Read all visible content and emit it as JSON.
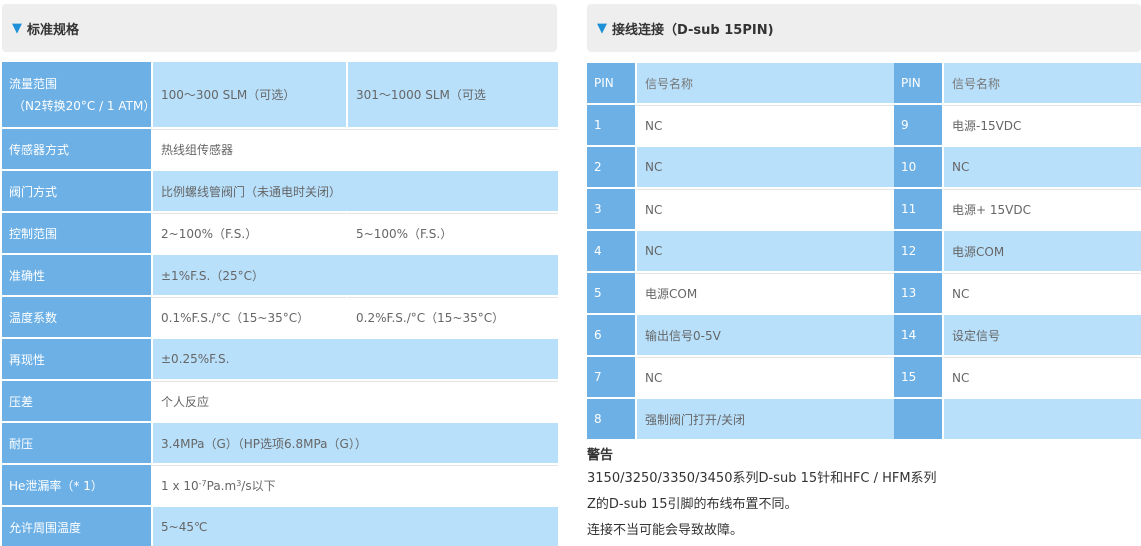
{
  "spec_section": {
    "title": "标准规格",
    "rows": [
      {
        "label": "流量范围",
        "sublabel": "（N2转换20°C / 1 ATM）",
        "value1": "100～300 SLM（可选）",
        "value2": "301～1000 SLM（可选"
      },
      {
        "label": "传感器方式",
        "value1": "热线组传感器"
      },
      {
        "label": "阀门方式",
        "value1": "比例螺线管阀门（未通电时关闭）"
      },
      {
        "label": "控制范围",
        "value1": "2~100%（F.S.）",
        "value2": "5~100%（F.S.）"
      },
      {
        "label": "准确性",
        "value1": "±1%F.S.（25°C）"
      },
      {
        "label": "温度系数",
        "value1": "0.1%F.S./°C（15~35°C）",
        "value2": "0.2%F.S./°C（15~35°C）"
      },
      {
        "label": "再现性",
        "value1": "±0.25%F.S."
      },
      {
        "label": "压差",
        "value1": "个人反应"
      },
      {
        "label": "耐压",
        "value1": "3.4MPa（G）（HP选项6.8MPa（G））"
      },
      {
        "label": "He泄漏率（* 1）",
        "value_prefix": "1 x 10",
        "value_exp1": "-7",
        "value_mid": " Pa.m",
        "value_exp2": "3",
        "value_suffix": "/s以下"
      },
      {
        "label": "允许周围温度",
        "value1": "5~45℃"
      }
    ]
  },
  "pin_section": {
    "title": "接线连接（D-sub 15PIN)",
    "header": {
      "pin": "PIN",
      "signal": "信号名称",
      "pin2": "PIN",
      "signal2": "信号名称"
    },
    "rows": [
      {
        "pin": "1",
        "signal": "NC",
        "pin2": "9",
        "signal2": "电源-15VDC"
      },
      {
        "pin": "2",
        "signal": "NC",
        "pin2": "10",
        "signal2": "NC"
      },
      {
        "pin": "3",
        "signal": "NC",
        "pin2": "11",
        "signal2": "电源+ 15VDC"
      },
      {
        "pin": "4",
        "signal": "NC",
        "pin2": "12",
        "signal2": "电源COM"
      },
      {
        "pin": "5",
        "signal": "电源COM",
        "pin2": "13",
        "signal2": "NC"
      },
      {
        "pin": "6",
        "signal": "输出信号0-5V",
        "pin2": "14",
        "signal2": "设定信号"
      },
      {
        "pin": "7",
        "signal": "NC",
        "pin2": "15",
        "signal2": "NC"
      },
      {
        "pin": "8",
        "signal": "强制阀门打开/关闭",
        "pin2": "",
        "signal2": ""
      }
    ]
  },
  "warning": {
    "title": "警告",
    "line1": "3150/3250/3350/3450系列D-sub 15针和HFC / HFM系列",
    "line2": "Z的D-sub 15引脚的布线布置不同。",
    "line3": "连接不当可能会导致故障。"
  },
  "icons": {
    "section_marker": "triangle-down-icon"
  },
  "colors": {
    "label_bg": "#6cb0e6",
    "blue_cell": "#b8e0fb",
    "header_bg": "#eeeeee",
    "marker": "#1e90d8"
  }
}
